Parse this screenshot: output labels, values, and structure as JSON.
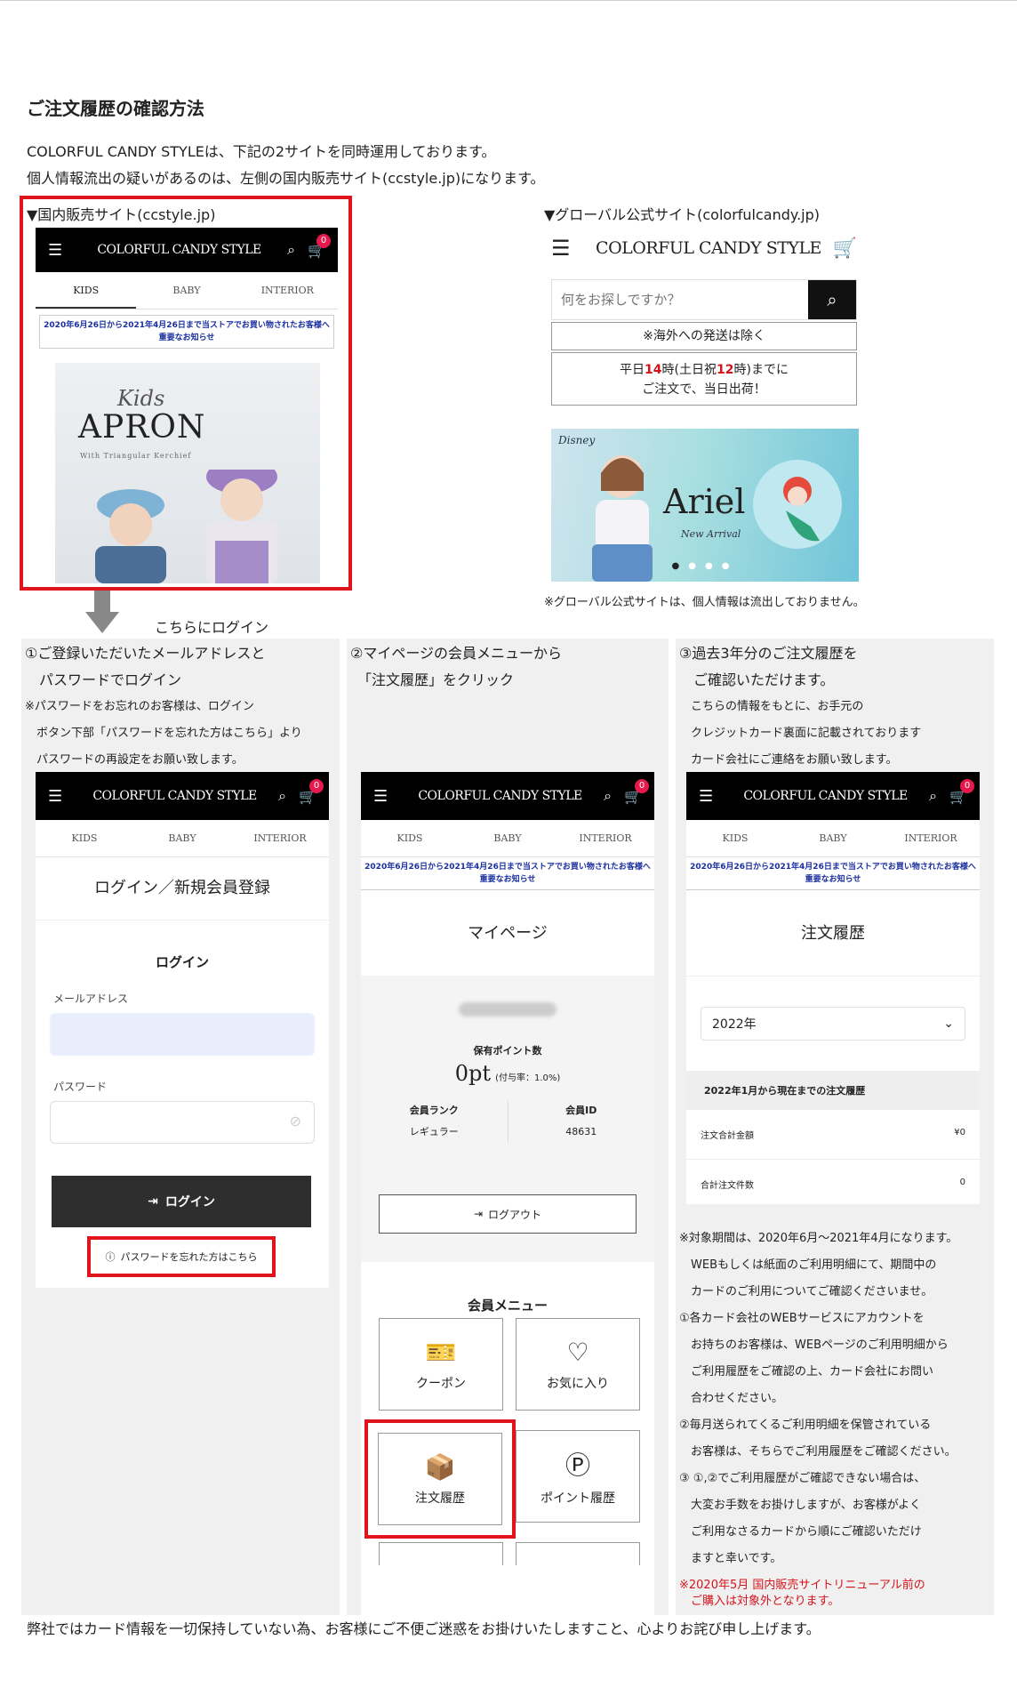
{
  "heading": "ご注文履歴の確認方法",
  "intro": [
    "COLORFUL CANDY STYLEは、下記の2サイトを同時運用しております。",
    "個人情報流出の疑いがあるのは、左側の国内販売サイト(ccstyle.jp)になります。"
  ],
  "domestic": {
    "label": "▼国内販売サイト(ccstyle.jp)",
    "logo": "COLORFUL CANDY STYLE",
    "cart_count": "0",
    "tabs": [
      "KIDS",
      "BABY",
      "INTERIOR"
    ],
    "notice": "2020年6月26日から2021年4月26日まで当ストアでお買い物されたお客様へ重要なお知らせ",
    "banner": {
      "kids": "Kids",
      "title": "APRON",
      "sub": "With Triangular Kerchief"
    }
  },
  "global": {
    "label": "▼グローバル公式サイト(colorfulcandy.jp)",
    "logo": "COLORFUL CANDY STYLE",
    "search_placeholder": "何をお探しですか？",
    "overseas": "※海外への発送は除く",
    "shipping_pre": "平日",
    "shipping_h1": "14",
    "shipping_mid": "時(土日祝",
    "shipping_h2": "12",
    "shipping_post": "時)までに",
    "shipping_line2": "ご注文で、当日出荷！",
    "banner_brand": "Disney",
    "banner_title": "Ariel",
    "banner_sub": "New Arrival",
    "note": "※グローバル公式サイトは、個人情報は流出しておりません。"
  },
  "login_here": "こちらにログイン",
  "step1": {
    "lines": [
      "①ご登録いただいたメールアドレスと",
      "　パスワードでログイン"
    ],
    "small": [
      "※パスワードをお忘れのお客様は、ログイン",
      "　ボタン下部「パスワードを忘れた方はこちら」より",
      "　パスワードの再設定をお願い致します。"
    ],
    "page_title": "ログイン／新規会員登録",
    "section": "ログイン",
    "email_label": "メールアドレス",
    "password_label": "パスワード",
    "login_button": "ログイン",
    "forgot": "パスワードを忘れた方はこちら"
  },
  "step2": {
    "lines": [
      "②マイページの会員メニューから",
      "　「注文履歴」をクリック"
    ],
    "page_title": "マイページ",
    "points_label": "保有ポイント数",
    "points": "0pt",
    "points_rate": "(付与率：1.0%)",
    "rank_label": "会員ランク",
    "rank": "レギュラー",
    "id_label": "会員ID",
    "member_id": "48631",
    "logout": "ログアウト",
    "menu_title": "会員メニュー",
    "tiles": [
      "クーポン",
      "お気に入り",
      "注文履歴",
      "ポイント履歴"
    ]
  },
  "step3": {
    "lines": [
      "③過去3年分のご注文履歴を",
      "　ご確認いただけます。"
    ],
    "small": [
      "　こちらの情報をもとに、お手元の",
      "　クレジットカード裏面に記載されております",
      "　カード会社にご連絡をお願い致します。"
    ],
    "page_title": "注文履歴",
    "year": "2022年",
    "summary_title": "2022年1月から現在までの注文履歴",
    "total_label": "注文合計金額",
    "total_value": "¥0",
    "count_label": "合計注文件数",
    "count_value": "0",
    "notes": [
      "※対象期間は、2020年6月～2021年4月になります。",
      "　WEBもしくは紙面のご利用明細にて、期間中の",
      "　カードのご利用についてご確認くださいませ。",
      "①各カード会社のWEBサービスにアカウントを",
      "　お持ちのお客様は、WEBページのご利用明細から",
      "　ご利用履歴をご確認の上、カード会社にお問い",
      "　合わせください。",
      "②毎月送られてくるご利用明細を保管されている",
      "　お客様は、そちらでご利用履歴をご確認ください。",
      "③ ①,②でご利用履歴がご確認できない場合は、",
      "　大変お手数をお掛けしますが、お客様がよく",
      "　ご利用なさるカードから順にご確認いただけ",
      "　ますと幸いです。"
    ],
    "red_note": [
      "※2020年5月 国内販売サイトリニューアル前の",
      "　ご購入は対象外となります。"
    ]
  },
  "footer": "弊社ではカード情報を一切保持していない為、お客様にご不便ご迷惑をお掛けいたしますこと、心よりお詫び申し上げます。",
  "colors": {
    "accent_red": "#e0141c",
    "notice_blue": "#1a2fa0",
    "badge": "#e5194c"
  }
}
